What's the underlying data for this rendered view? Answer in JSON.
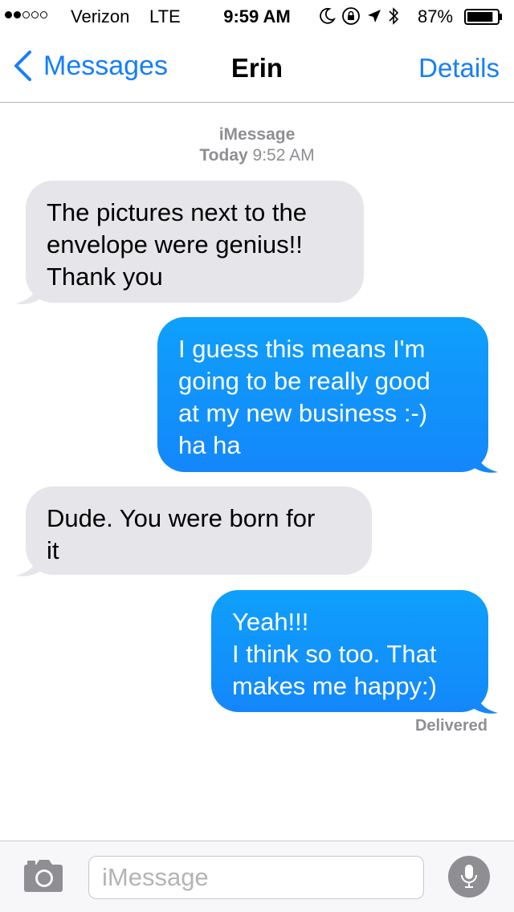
{
  "status_bar": {
    "signal_bars_filled": 2,
    "signal_bars_total": 5,
    "carrier": "Verizon",
    "network": "LTE",
    "time": "9:59 AM",
    "icons": [
      "moon-icon",
      "rotation-lock-icon",
      "location-arrow-icon",
      "bluetooth-icon"
    ],
    "battery_percent": "87%",
    "battery_level": 0.87
  },
  "nav": {
    "back_label": "Messages",
    "title": "Erin",
    "details_label": "Details"
  },
  "conversation": {
    "service": "iMessage",
    "day": "Today",
    "time": "9:52 AM"
  },
  "messages": [
    {
      "direction": "received",
      "lines": [
        "The pictures next to the",
        "envelope were genius!!",
        "Thank you"
      ]
    },
    {
      "direction": "sent",
      "lines": [
        "I guess this means I'm",
        "going to be really good",
        "at my new business :-)",
        "ha ha"
      ]
    },
    {
      "direction": "received",
      "lines": [
        "Dude. You were born for",
        "it"
      ]
    },
    {
      "direction": "sent",
      "lines": [
        "Yeah!!!",
        "I think so too. That",
        "makes me happy:)"
      ]
    }
  ],
  "delivery_status": "Delivered",
  "input": {
    "placeholder": "iMessage",
    "value": ""
  },
  "colors": {
    "accent": "#157efb",
    "received_bubble": "#e5e5ea",
    "sent_bubble_top": "#0ea0fb",
    "sent_bubble_bottom": "#1487fb",
    "secondary_text": "#8e8e93"
  }
}
